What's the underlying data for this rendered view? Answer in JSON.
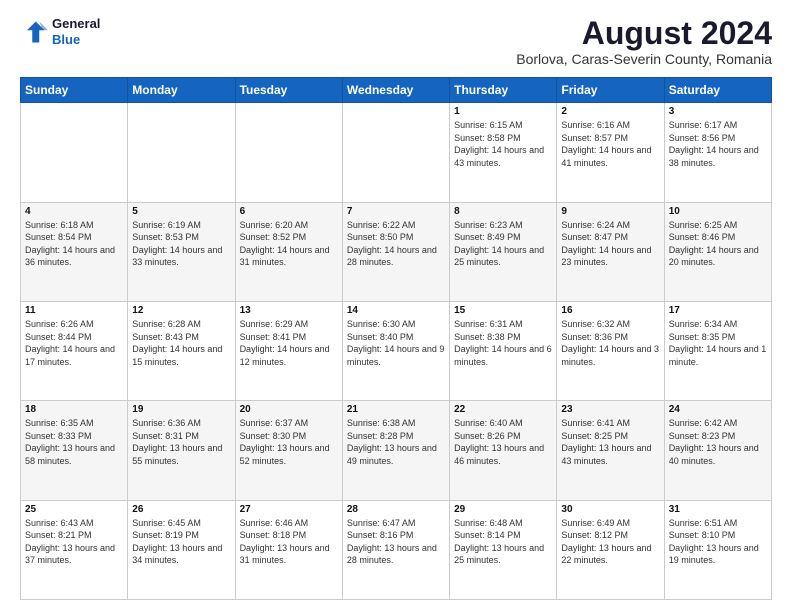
{
  "logo": {
    "line1": "General",
    "line2": "Blue"
  },
  "title": "August 2024",
  "subtitle": "Borlova, Caras-Severin County, Romania",
  "weekdays": [
    "Sunday",
    "Monday",
    "Tuesday",
    "Wednesday",
    "Thursday",
    "Friday",
    "Saturday"
  ],
  "weeks": [
    [
      {
        "day": "",
        "sunrise": "",
        "sunset": "",
        "daylight": ""
      },
      {
        "day": "",
        "sunrise": "",
        "sunset": "",
        "daylight": ""
      },
      {
        "day": "",
        "sunrise": "",
        "sunset": "",
        "daylight": ""
      },
      {
        "day": "",
        "sunrise": "",
        "sunset": "",
        "daylight": ""
      },
      {
        "day": "1",
        "sunrise": "Sunrise: 6:15 AM",
        "sunset": "Sunset: 8:58 PM",
        "daylight": "Daylight: 14 hours and 43 minutes."
      },
      {
        "day": "2",
        "sunrise": "Sunrise: 6:16 AM",
        "sunset": "Sunset: 8:57 PM",
        "daylight": "Daylight: 14 hours and 41 minutes."
      },
      {
        "day": "3",
        "sunrise": "Sunrise: 6:17 AM",
        "sunset": "Sunset: 8:56 PM",
        "daylight": "Daylight: 14 hours and 38 minutes."
      }
    ],
    [
      {
        "day": "4",
        "sunrise": "Sunrise: 6:18 AM",
        "sunset": "Sunset: 8:54 PM",
        "daylight": "Daylight: 14 hours and 36 minutes."
      },
      {
        "day": "5",
        "sunrise": "Sunrise: 6:19 AM",
        "sunset": "Sunset: 8:53 PM",
        "daylight": "Daylight: 14 hours and 33 minutes."
      },
      {
        "day": "6",
        "sunrise": "Sunrise: 6:20 AM",
        "sunset": "Sunset: 8:52 PM",
        "daylight": "Daylight: 14 hours and 31 minutes."
      },
      {
        "day": "7",
        "sunrise": "Sunrise: 6:22 AM",
        "sunset": "Sunset: 8:50 PM",
        "daylight": "Daylight: 14 hours and 28 minutes."
      },
      {
        "day": "8",
        "sunrise": "Sunrise: 6:23 AM",
        "sunset": "Sunset: 8:49 PM",
        "daylight": "Daylight: 14 hours and 25 minutes."
      },
      {
        "day": "9",
        "sunrise": "Sunrise: 6:24 AM",
        "sunset": "Sunset: 8:47 PM",
        "daylight": "Daylight: 14 hours and 23 minutes."
      },
      {
        "day": "10",
        "sunrise": "Sunrise: 6:25 AM",
        "sunset": "Sunset: 8:46 PM",
        "daylight": "Daylight: 14 hours and 20 minutes."
      }
    ],
    [
      {
        "day": "11",
        "sunrise": "Sunrise: 6:26 AM",
        "sunset": "Sunset: 8:44 PM",
        "daylight": "Daylight: 14 hours and 17 minutes."
      },
      {
        "day": "12",
        "sunrise": "Sunrise: 6:28 AM",
        "sunset": "Sunset: 8:43 PM",
        "daylight": "Daylight: 14 hours and 15 minutes."
      },
      {
        "day": "13",
        "sunrise": "Sunrise: 6:29 AM",
        "sunset": "Sunset: 8:41 PM",
        "daylight": "Daylight: 14 hours and 12 minutes."
      },
      {
        "day": "14",
        "sunrise": "Sunrise: 6:30 AM",
        "sunset": "Sunset: 8:40 PM",
        "daylight": "Daylight: 14 hours and 9 minutes."
      },
      {
        "day": "15",
        "sunrise": "Sunrise: 6:31 AM",
        "sunset": "Sunset: 8:38 PM",
        "daylight": "Daylight: 14 hours and 6 minutes."
      },
      {
        "day": "16",
        "sunrise": "Sunrise: 6:32 AM",
        "sunset": "Sunset: 8:36 PM",
        "daylight": "Daylight: 14 hours and 3 minutes."
      },
      {
        "day": "17",
        "sunrise": "Sunrise: 6:34 AM",
        "sunset": "Sunset: 8:35 PM",
        "daylight": "Daylight: 14 hours and 1 minute."
      }
    ],
    [
      {
        "day": "18",
        "sunrise": "Sunrise: 6:35 AM",
        "sunset": "Sunset: 8:33 PM",
        "daylight": "Daylight: 13 hours and 58 minutes."
      },
      {
        "day": "19",
        "sunrise": "Sunrise: 6:36 AM",
        "sunset": "Sunset: 8:31 PM",
        "daylight": "Daylight: 13 hours and 55 minutes."
      },
      {
        "day": "20",
        "sunrise": "Sunrise: 6:37 AM",
        "sunset": "Sunset: 8:30 PM",
        "daylight": "Daylight: 13 hours and 52 minutes."
      },
      {
        "day": "21",
        "sunrise": "Sunrise: 6:38 AM",
        "sunset": "Sunset: 8:28 PM",
        "daylight": "Daylight: 13 hours and 49 minutes."
      },
      {
        "day": "22",
        "sunrise": "Sunrise: 6:40 AM",
        "sunset": "Sunset: 8:26 PM",
        "daylight": "Daylight: 13 hours and 46 minutes."
      },
      {
        "day": "23",
        "sunrise": "Sunrise: 6:41 AM",
        "sunset": "Sunset: 8:25 PM",
        "daylight": "Daylight: 13 hours and 43 minutes."
      },
      {
        "day": "24",
        "sunrise": "Sunrise: 6:42 AM",
        "sunset": "Sunset: 8:23 PM",
        "daylight": "Daylight: 13 hours and 40 minutes."
      }
    ],
    [
      {
        "day": "25",
        "sunrise": "Sunrise: 6:43 AM",
        "sunset": "Sunset: 8:21 PM",
        "daylight": "Daylight: 13 hours and 37 minutes."
      },
      {
        "day": "26",
        "sunrise": "Sunrise: 6:45 AM",
        "sunset": "Sunset: 8:19 PM",
        "daylight": "Daylight: 13 hours and 34 minutes."
      },
      {
        "day": "27",
        "sunrise": "Sunrise: 6:46 AM",
        "sunset": "Sunset: 8:18 PM",
        "daylight": "Daylight: 13 hours and 31 minutes."
      },
      {
        "day": "28",
        "sunrise": "Sunrise: 6:47 AM",
        "sunset": "Sunset: 8:16 PM",
        "daylight": "Daylight: 13 hours and 28 minutes."
      },
      {
        "day": "29",
        "sunrise": "Sunrise: 6:48 AM",
        "sunset": "Sunset: 8:14 PM",
        "daylight": "Daylight: 13 hours and 25 minutes."
      },
      {
        "day": "30",
        "sunrise": "Sunrise: 6:49 AM",
        "sunset": "Sunset: 8:12 PM",
        "daylight": "Daylight: 13 hours and 22 minutes."
      },
      {
        "day": "31",
        "sunrise": "Sunrise: 6:51 AM",
        "sunset": "Sunset: 8:10 PM",
        "daylight": "Daylight: 13 hours and 19 minutes."
      }
    ]
  ]
}
